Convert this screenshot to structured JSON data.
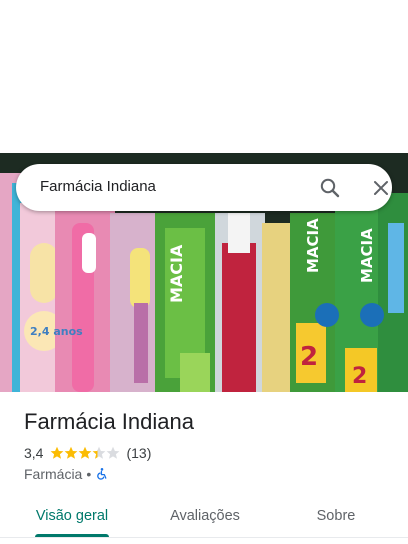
{
  "search": {
    "query": "Farmácia Indiana"
  },
  "place": {
    "name": "Farmácia Indiana",
    "rating": "3,4",
    "rating_stars": 3.4,
    "review_count": "(13)",
    "category": "Farmácia",
    "separator": "•"
  },
  "tabs": [
    {
      "label": "Visão geral",
      "active": true
    },
    {
      "label": "Avaliações",
      "active": false
    },
    {
      "label": "Sobre",
      "active": false
    }
  ],
  "colors": {
    "accent": "#00796b",
    "star": "#fbbc04",
    "star_empty": "#dadce0",
    "accessibility": "#1a73e8"
  },
  "hero": {
    "icon": "photo-toothbrushes-display",
    "texts": [
      "MACIA",
      "2,4 anos",
      "2"
    ]
  },
  "icons": {
    "search": "search-icon",
    "close": "close-icon",
    "wheelchair": "wheelchair-accessible-icon"
  }
}
